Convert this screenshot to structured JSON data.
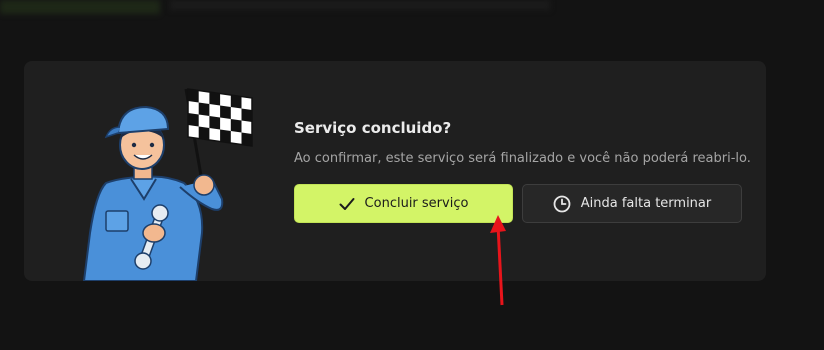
{
  "dialog": {
    "title": "Serviço concluido?",
    "description": "Ao confirmar, este serviço será finalizado e você não poderá reabri-lo.",
    "illustration": "mechanic-with-checkered-flag"
  },
  "buttons": {
    "confirm": {
      "label": "Concluir serviço",
      "icon": "checkmark-icon"
    },
    "pending": {
      "label": "Ainda falta terminar",
      "icon": "clock-icon"
    }
  },
  "annotation": {
    "color": "#e8141b",
    "type": "arrow-pointing-to-confirm-button"
  },
  "colors": {
    "accent": "#d3f467",
    "background": "#131313",
    "card": "#1f1f1f",
    "secondary_button": "#272727"
  }
}
